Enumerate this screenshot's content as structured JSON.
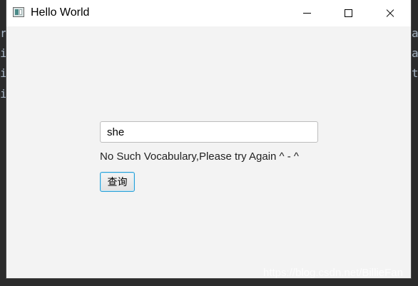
{
  "window": {
    "title": "Hello World",
    "controls": {
      "minimize_icon": "minimize-icon",
      "maximize_icon": "maximize-icon",
      "close_icon": "close-icon"
    }
  },
  "form": {
    "search_value": "she",
    "result_message": "No Such Vocabulary,Please try Again ^ - ^",
    "query_button_label": "查询"
  },
  "background": {
    "glyphs": [
      "r",
      "i",
      "i",
      "i"
    ],
    "right_glyphs": [
      "a",
      "a",
      "t"
    ]
  },
  "watermark": "https://blog.csdn.net/BillieFan",
  "colors": {
    "window_bg": "#f3f3f3",
    "titlebar_bg": "#ffffff",
    "editor_bg": "#2b2b2b",
    "focus_accent": "#2a9fd6"
  }
}
